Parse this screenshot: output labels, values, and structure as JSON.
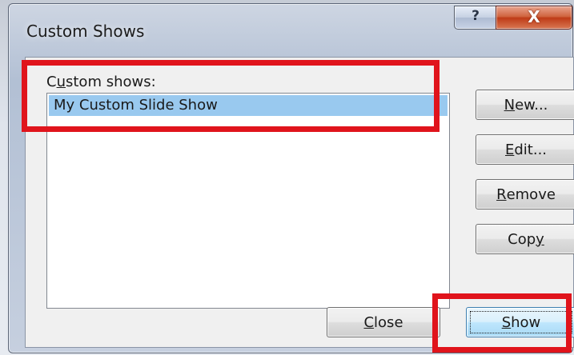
{
  "window": {
    "title": "Custom Shows",
    "help_glyph": "?",
    "close_glyph": "X"
  },
  "dialog": {
    "list_label_pre": "C",
    "list_label_accel": "u",
    "list_label_post": "stom shows:",
    "items": [
      "My Custom Slide Show"
    ],
    "selected_index": 0
  },
  "buttons": {
    "new": {
      "accel": "N",
      "rest": "ew..."
    },
    "edit": {
      "accel": "E",
      "rest": "dit..."
    },
    "remove": {
      "accel": "R",
      "rest": "emove"
    },
    "copy": {
      "pre": "Cop",
      "accel": "y",
      "rest": ""
    },
    "close": {
      "accel": "C",
      "rest": "lose"
    },
    "show": {
      "accel": "S",
      "rest": "how"
    }
  },
  "annotations": {
    "highlight_color": "#e0141c",
    "highlight_list_box": true,
    "highlight_show_button": true
  }
}
